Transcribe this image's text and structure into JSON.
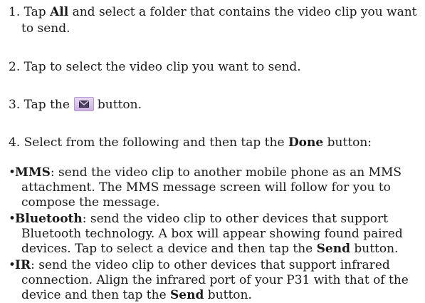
{
  "steps": {
    "s1": {
      "num": "1. Tap ",
      "bold": "All",
      "rest": " and select a folder that contains the video clip you want",
      "cont": "to send."
    },
    "s2": {
      "text": "2. Tap to select the video clip you want to send."
    },
    "s3": {
      "before": "3. Tap the",
      "icon": "envelope-send-icon",
      "after": "button."
    },
    "s4": {
      "before": "4. Select from the following and then tap the ",
      "bold": "Done",
      "after": " button:"
    }
  },
  "options": [
    {
      "bullet": "•",
      "name": "MMS",
      "line1": ": send the video clip to another mobile phone as an MMS",
      "line2": "attachment. The MMS message screen will follow for you to",
      "line3": "compose the message."
    },
    {
      "bullet": "•",
      "name": "Bluetooth",
      "line1": ": send the video clip to other devices that support",
      "line2": "Bluetooth technology. A box will appear showing found paired",
      "line3a": "devices. Tap to select a device and then tap the ",
      "line3b": "Send",
      "line3c": " button."
    },
    {
      "bullet": "•",
      "name": "IR",
      "line1": ": send the video clip to other devices that support infrared",
      "line2": "connection. Align the infrared port of your P31 with that of the",
      "line3a": "device and then tap the ",
      "line3b": "Send",
      "line3c": " button."
    }
  ],
  "colors": {
    "text": "#1a1a1a",
    "button_fill": "#d8c4ea"
  }
}
